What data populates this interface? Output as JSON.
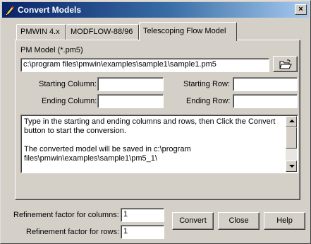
{
  "window": {
    "title": "Convert Models",
    "close_glyph": "×",
    "colors": {
      "face": "#d4d0c8",
      "titlebar_start": "#0a246a",
      "titlebar_end": "#a6caf0"
    }
  },
  "tabs": [
    {
      "label": "PMWIN 4.x",
      "active": false
    },
    {
      "label": "MODFLOW-88/96",
      "active": false
    },
    {
      "label": "Telescoping Flow Model",
      "active": true
    }
  ],
  "pm_model": {
    "label": "PM Model (*.pm5)",
    "path": "c:\\program files\\pmwin\\examples\\sample1\\sample1.pm5",
    "browse_icon": "open-folder-icon"
  },
  "fields": {
    "starting_column_label": "Starting Column:",
    "starting_column_value": "",
    "starting_row_label": "Starting Row:",
    "starting_row_value": "",
    "ending_column_label": "Ending Column:",
    "ending_column_value": "",
    "ending_row_label": "Ending Row:",
    "ending_row_value": ""
  },
  "info": {
    "line1": "Type in the starting and ending columns and rows, then Click the Convert button to start the conversion.",
    "line2": "The converted model will be saved in c:\\program files\\pmwin\\examples\\sample1\\pm5_1\\"
  },
  "refinement": {
    "columns_label": "Refinement factor for columns:",
    "columns_value": "1",
    "rows_label": "Refinement factor for rows:",
    "rows_value": "1"
  },
  "buttons": {
    "convert": "Convert",
    "close": "Close",
    "help": "Help"
  }
}
